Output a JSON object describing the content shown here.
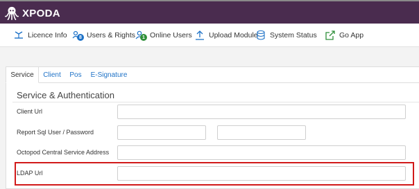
{
  "app": {
    "name": "XPODA"
  },
  "nav": {
    "items": [
      {
        "label": "Licence Info",
        "icon": "licence-icon"
      },
      {
        "label": "Users & Rights",
        "icon": "users-rights-icon",
        "badge": "8"
      },
      {
        "label": "Online Users",
        "icon": "online-users-icon",
        "badge": "1"
      },
      {
        "label": "Upload Module",
        "icon": "upload-icon"
      },
      {
        "label": "System Status",
        "icon": "database-icon"
      },
      {
        "label": "Go App",
        "icon": "external-link-icon"
      }
    ]
  },
  "tabs": [
    {
      "label": "Service",
      "active": true
    },
    {
      "label": "Client",
      "active": false
    },
    {
      "label": "Pos",
      "active": false
    },
    {
      "label": "E-Signature",
      "active": false
    }
  ],
  "section": {
    "title": "Service & Authentication"
  },
  "form": {
    "client_url": {
      "label": "Client Url",
      "value": ""
    },
    "report_sql": {
      "label": "Report Sql User / Password",
      "user": "",
      "password": ""
    },
    "octopod_address": {
      "label": "Octopod Central Service Address",
      "value": ""
    },
    "ldap_url": {
      "label": "LDAP Url",
      "value": ""
    }
  },
  "colors": {
    "topbar": "#4a2c4f",
    "accent": "#1e72c7",
    "highlight": "#d11a1a"
  }
}
